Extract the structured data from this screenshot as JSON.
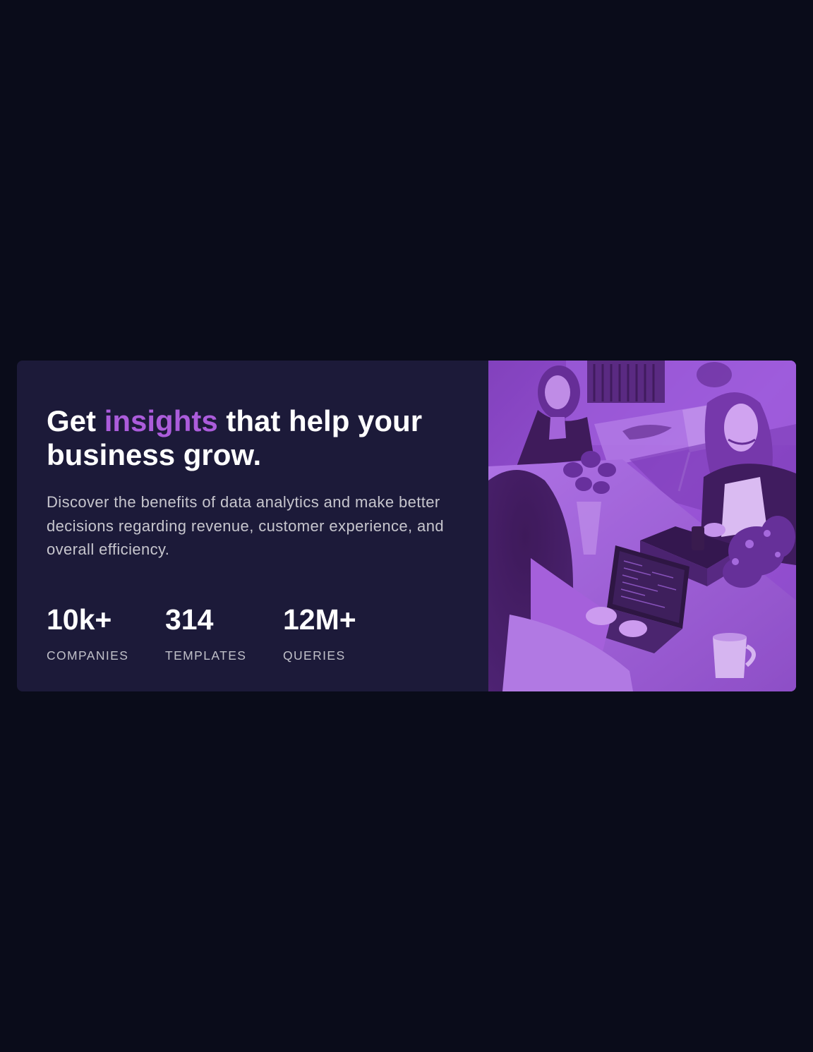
{
  "hero": {
    "headline_before": "Get ",
    "headline_accent": "insights",
    "headline_after": " that help your business grow.",
    "description": "Discover the benefits of data analytics and make better decisions regarding revenue, customer experience, and overall efficiency."
  },
  "stats": [
    {
      "value": "10k+",
      "label": "COMPANIES"
    },
    {
      "value": "314",
      "label": "TEMPLATES"
    },
    {
      "value": "12M+",
      "label": "QUERIES"
    }
  ],
  "image": {
    "icon": "team-meeting-photo-icon"
  },
  "colors": {
    "background": "#0a0c1a",
    "card": "#1c1a39",
    "accent": "#ab5cdb",
    "text": "#ffffff"
  }
}
